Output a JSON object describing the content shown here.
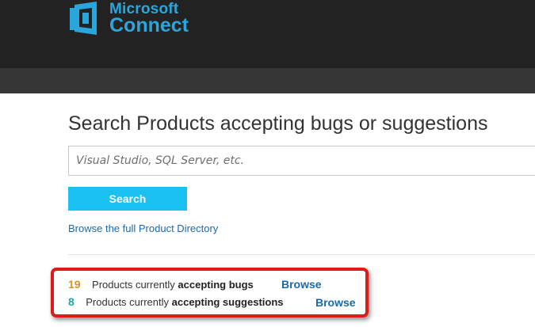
{
  "brand": {
    "line1": "Microsoft",
    "line2": "Connect",
    "color": "#2aa6dc"
  },
  "search": {
    "heading": "Search Products accepting bugs or suggestions",
    "placeholder": "Visual Studio, SQL Server, etc.",
    "button_label": "Search",
    "directory_link": "Browse the full Product Directory"
  },
  "stats": {
    "bugs": {
      "count": "19",
      "prefix": "Products currently",
      "emphasis": "accepting bugs",
      "browse_label": "Browse"
    },
    "suggestions": {
      "count": "8",
      "prefix": "Products currently",
      "emphasis": "accepting suggestions",
      "browse_label": "Browse"
    }
  },
  "colors": {
    "header_bg": "#222222",
    "subheader_bg": "#363636",
    "accent_button": "#19c0f0",
    "link": "#1a6aa8",
    "bugs_count": "#d8951a",
    "suggestions_count": "#1fa6a6",
    "highlight_border": "#e01919"
  }
}
